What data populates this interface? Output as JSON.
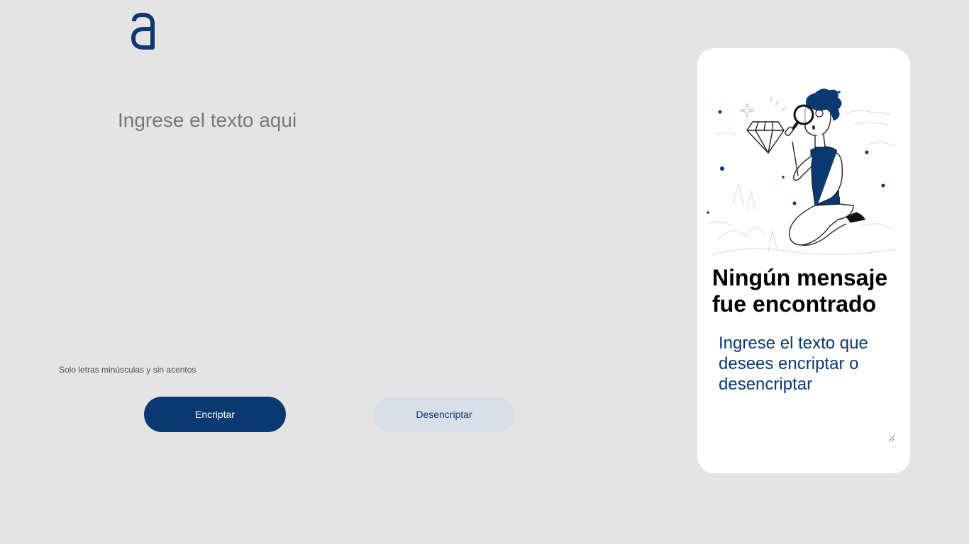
{
  "brand": {
    "logo_letter": "a",
    "accent_color": "#0a3871"
  },
  "input": {
    "placeholder": "Ingrese el texto aqui",
    "value": ""
  },
  "hint": {
    "text": "Solo letras minúsculas y sin acentos",
    "icon": "info-icon"
  },
  "buttons": {
    "encrypt_label": "Encriptar",
    "decrypt_label": "Desencriptar"
  },
  "output_panel": {
    "illustration": "person-with-magnifying-glass",
    "title": "Ningún mensaje fue encontrado",
    "placeholder": "Ingrese el texto que desees encriptar o desencriptar",
    "value": ""
  }
}
